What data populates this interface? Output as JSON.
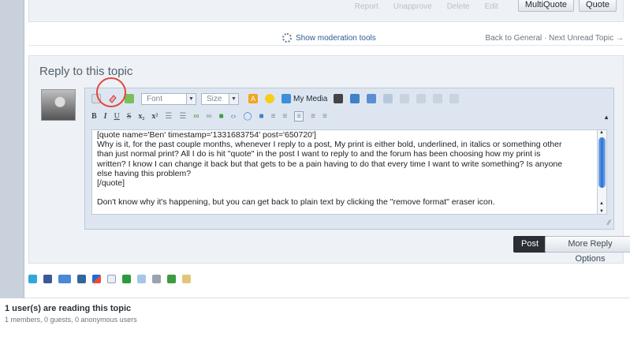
{
  "post_actions": {
    "links": [
      "Report",
      "Unapprove",
      "Delete",
      "Edit"
    ],
    "multiquote": "MultiQuote",
    "quote": "Quote"
  },
  "moderation": {
    "show_tools": "Show moderation tools",
    "nav": "Back to General · Next Unread Topic →"
  },
  "reply": {
    "title": "Reply to this topic",
    "font_select": "Font",
    "size_select": "Size",
    "my_media": "My Media",
    "text_lines": [
      "[quote name='Ben' timestamp='1331683754' post='650720']",
      "Why is it, for the past couple months, whenever I reply to a post, My print is either bold, underlined, in italics or something other",
      "than just normal print? All I do is hit \"quote\" in the post I want to reply to and the forum has been choosing how my print is",
      "written? I know I can change it back but that gets to be a pain having to do that every time I want to write something? Is anyone",
      "else having this problem?",
      "[/quote]",
      "",
      "Don't know why it's happening, but you can get back to plain text by clicking the \"remove format\" eraser icon."
    ],
    "post_button": "Post",
    "more_options_button": "More Reply Options"
  },
  "readers": {
    "title": "1 user(s) are reading this topic",
    "subtitle": "1 members, 0 guests, 0 anonymous users"
  },
  "colors": {
    "highlight_circle": "#e3453c",
    "link": "#2b5c93",
    "accent_dark": "#2a2f35"
  }
}
